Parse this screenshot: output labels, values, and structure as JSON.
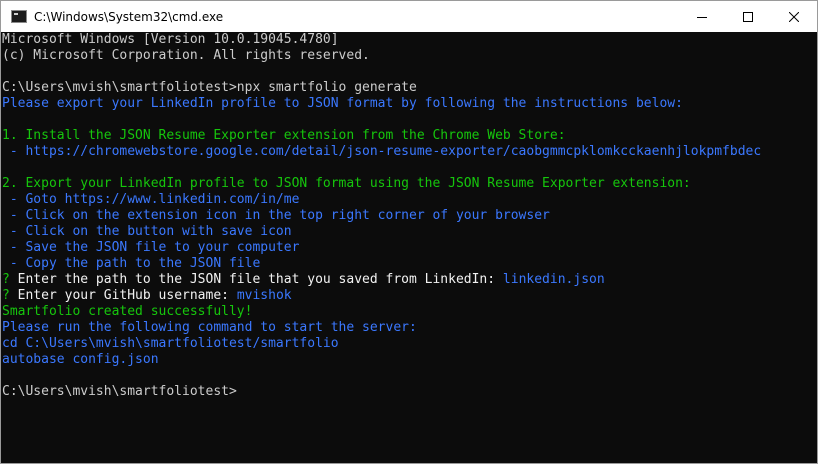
{
  "window": {
    "title": "C:\\Windows\\System32\\cmd.exe",
    "icon": "cmd-icon"
  },
  "colors": {
    "background": "#0c0c0c",
    "default": "#cccccc",
    "blue": "#3b78ff",
    "green": "#16c60c",
    "bright": "#f2f2f2"
  },
  "lines": [
    {
      "segments": [
        {
          "text": "Microsoft Windows [Version 10.0.19045.4780]",
          "color": "default"
        }
      ]
    },
    {
      "segments": [
        {
          "text": "(c) Microsoft Corporation. All rights reserved.",
          "color": "default"
        }
      ]
    },
    {
      "segments": [
        {
          "text": "",
          "color": "default"
        }
      ]
    },
    {
      "segments": [
        {
          "text": "C:\\Users\\mvish\\smartfoliotest>npx smartfolio generate",
          "color": "default"
        }
      ]
    },
    {
      "segments": [
        {
          "text": "Please export your LinkedIn profile to JSON format by following the instructions below:",
          "color": "blue"
        }
      ]
    },
    {
      "segments": [
        {
          "text": "",
          "color": "default"
        }
      ]
    },
    {
      "segments": [
        {
          "text": "1. Install the JSON Resume Exporter extension from the Chrome Web Store:",
          "color": "green"
        }
      ]
    },
    {
      "segments": [
        {
          "text": " - https://chromewebstore.google.com/detail/json-resume-exporter/caobgmmcpklomkcckaenhjlokpmfbdec",
          "color": "blue"
        }
      ]
    },
    {
      "segments": [
        {
          "text": "",
          "color": "default"
        }
      ]
    },
    {
      "segments": [
        {
          "text": "2. Export your LinkedIn profile to JSON format using the JSON Resume Exporter extension:",
          "color": "green"
        }
      ]
    },
    {
      "segments": [
        {
          "text": " - Goto https://www.linkedin.com/in/me",
          "color": "blue"
        }
      ]
    },
    {
      "segments": [
        {
          "text": " - Click on the extension icon in the top right corner of your browser",
          "color": "blue"
        }
      ]
    },
    {
      "segments": [
        {
          "text": " - Click on the button with save icon",
          "color": "blue"
        }
      ]
    },
    {
      "segments": [
        {
          "text": " - Save the JSON file to your computer",
          "color": "blue"
        }
      ]
    },
    {
      "segments": [
        {
          "text": " - Copy the path to the JSON file",
          "color": "blue"
        }
      ]
    },
    {
      "segments": [
        {
          "text": "? ",
          "color": "green"
        },
        {
          "text": "Enter the path to the JSON file that you saved from LinkedIn: ",
          "color": "bright"
        },
        {
          "text": "linkedin.json",
          "color": "blue"
        }
      ]
    },
    {
      "segments": [
        {
          "text": "? ",
          "color": "green"
        },
        {
          "text": "Enter your GitHub username: ",
          "color": "bright"
        },
        {
          "text": "mvishok",
          "color": "blue"
        }
      ]
    },
    {
      "segments": [
        {
          "text": "Smartfolio created successfully!",
          "color": "green"
        }
      ]
    },
    {
      "segments": [
        {
          "text": "Please run the following command to start the server:",
          "color": "blue"
        }
      ]
    },
    {
      "segments": [
        {
          "text": "cd C:\\Users\\mvish\\smartfoliotest/smartfolio",
          "color": "blue"
        }
      ]
    },
    {
      "segments": [
        {
          "text": "autobase config.json",
          "color": "blue"
        }
      ]
    },
    {
      "segments": [
        {
          "text": "",
          "color": "default"
        }
      ]
    },
    {
      "segments": [
        {
          "text": "C:\\Users\\mvish\\smartfoliotest>",
          "color": "default"
        }
      ]
    }
  ]
}
